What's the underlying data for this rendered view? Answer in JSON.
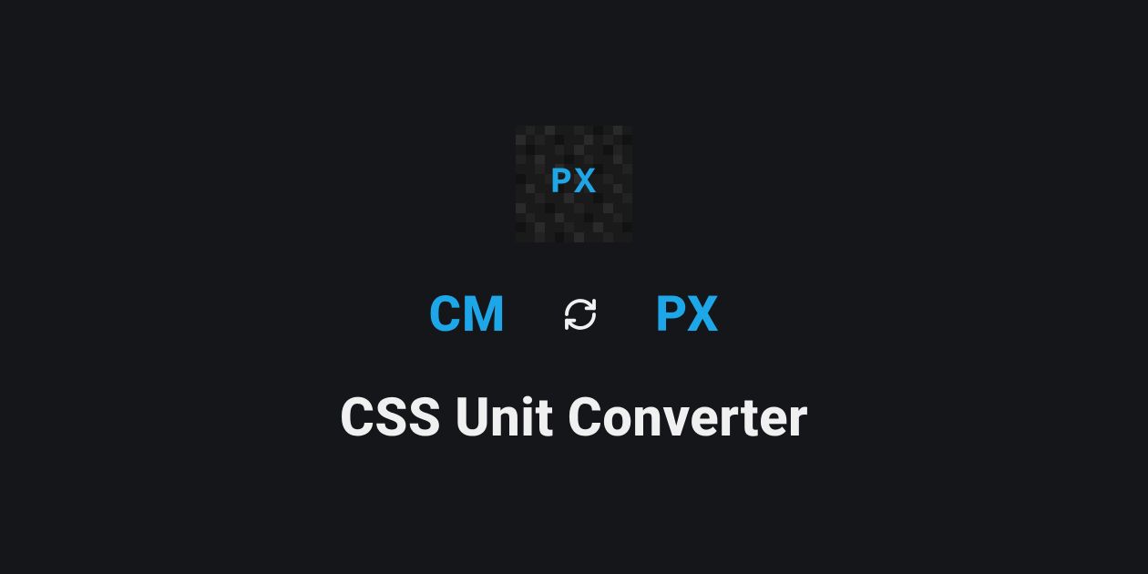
{
  "logo": {
    "text": "PX"
  },
  "converter": {
    "unit_from": "CM",
    "unit_to": "PX",
    "swap_icon_name": "swap-icon"
  },
  "page": {
    "title": "CSS Unit Converter"
  },
  "colors": {
    "background": "#14161a",
    "accent": "#1ea7e8",
    "text": "#f0f0f0"
  }
}
